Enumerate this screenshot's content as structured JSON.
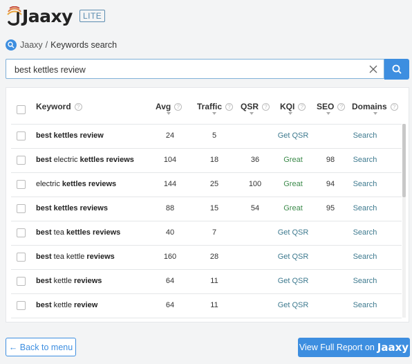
{
  "brand": {
    "name": "Jaaxy",
    "badge": "LITE"
  },
  "breadcrumb": {
    "root": "Jaaxy",
    "separator": "/",
    "current": "Keywords search"
  },
  "search": {
    "value": "best kettles review",
    "placeholder": ""
  },
  "table": {
    "columns": [
      "Keyword",
      "Avg",
      "Traffic",
      "QSR",
      "KQI",
      "SEO",
      "Domains"
    ],
    "rows": [
      {
        "keyword_parts": [
          [
            "best kettles review",
            true
          ]
        ],
        "avg": "24",
        "traffic": "5",
        "qsr": "",
        "kqi": "Get QSR",
        "kqi_type": "link",
        "seo": "",
        "domains": "Search"
      },
      {
        "keyword_parts": [
          [
            "best",
            true
          ],
          [
            " electric ",
            false
          ],
          [
            "kettles reviews",
            true
          ]
        ],
        "avg": "104",
        "traffic": "18",
        "qsr": "36",
        "kqi": "Great",
        "kqi_type": "status",
        "seo": "98",
        "domains": "Search"
      },
      {
        "keyword_parts": [
          [
            "electric ",
            false
          ],
          [
            "kettles reviews",
            true
          ]
        ],
        "avg": "144",
        "traffic": "25",
        "qsr": "100",
        "kqi": "Great",
        "kqi_type": "status",
        "seo": "94",
        "domains": "Search"
      },
      {
        "keyword_parts": [
          [
            "best kettles reviews",
            true
          ]
        ],
        "avg": "88",
        "traffic": "15",
        "qsr": "54",
        "kqi": "Great",
        "kqi_type": "status",
        "seo": "95",
        "domains": "Search"
      },
      {
        "keyword_parts": [
          [
            "best",
            true
          ],
          [
            " tea ",
            false
          ],
          [
            "kettles reviews",
            true
          ]
        ],
        "avg": "40",
        "traffic": "7",
        "qsr": "",
        "kqi": "Get QSR",
        "kqi_type": "link",
        "seo": "",
        "domains": "Search"
      },
      {
        "keyword_parts": [
          [
            "best",
            true
          ],
          [
            " tea kettle ",
            false
          ],
          [
            "reviews",
            true
          ]
        ],
        "avg": "160",
        "traffic": "28",
        "qsr": "",
        "kqi": "Get QSR",
        "kqi_type": "link",
        "seo": "",
        "domains": "Search"
      },
      {
        "keyword_parts": [
          [
            "best",
            true
          ],
          [
            " kettle ",
            false
          ],
          [
            "reviews",
            true
          ]
        ],
        "avg": "64",
        "traffic": "11",
        "qsr": "",
        "kqi": "Get QSR",
        "kqi_type": "link",
        "seo": "",
        "domains": "Search"
      },
      {
        "keyword_parts": [
          [
            "best",
            true
          ],
          [
            " kettle ",
            false
          ],
          [
            "review",
            true
          ]
        ],
        "avg": "64",
        "traffic": "11",
        "qsr": "",
        "kqi": "Get QSR",
        "kqi_type": "link",
        "seo": "",
        "domains": "Search"
      }
    ]
  },
  "footer": {
    "back_label": "← Back to menu",
    "full_report_label": "View Full Report on",
    "full_report_brand": "Jaaxy"
  },
  "colors": {
    "accent": "#3d8ee0",
    "great": "#3b8a4a",
    "link": "#3e7a8f"
  },
  "icons": [
    "search-icon",
    "clear-icon",
    "help-icon",
    "sort-down-icon",
    "checkbox-icon"
  ]
}
